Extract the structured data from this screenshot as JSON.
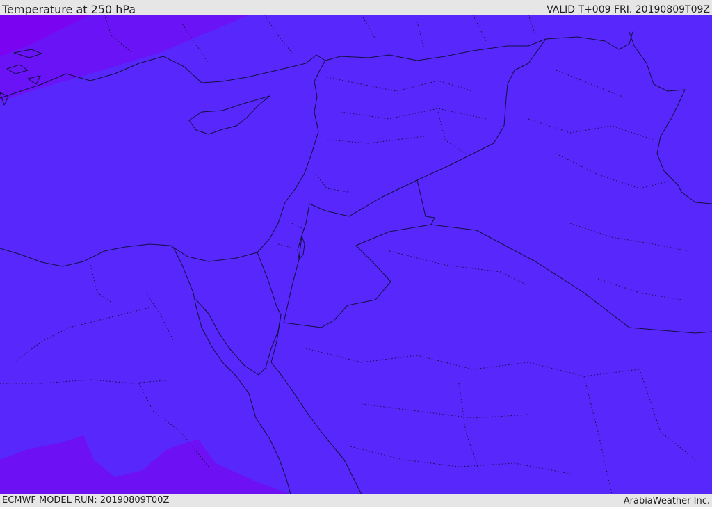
{
  "header": {
    "title": "Temperature at 250 hPa",
    "valid_time": "VALID T+009 FRI. 20190809T09Z"
  },
  "footer": {
    "model_run": "ECMWF MODEL RUN: 20190809T00Z",
    "credit": "ArabiaWeather Inc."
  },
  "map": {
    "field": "temperature",
    "level": "250 hPa",
    "colors": {
      "background_field": "#5827fb",
      "colder_band": "#6a13f6",
      "coldest_band": "#7a04f2",
      "southwest_band": "#6e10f4",
      "boundaries": "#101040"
    }
  }
}
